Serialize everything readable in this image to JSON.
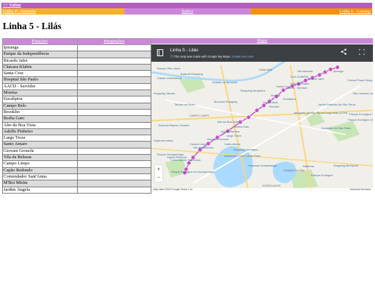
{
  "top": {
    "back": "<< Voltar"
  },
  "nav": {
    "prev": "Linha 4 - Amarela",
    "index": "Índice",
    "next": "Linha 6 - Laranja"
  },
  "title": "Linha 5 - Lilás",
  "table": {
    "headers": [
      "Estações",
      "Integrações"
    ],
    "stations": [
      "Ipiranga",
      "Parque da Independência",
      "Ricardo Jafet",
      "Chácara Klabin",
      "Santa Cruz",
      "Hospital São Paulo",
      "AACD - Servidor",
      "Moema",
      "Eucaliptos",
      "Campo Belo",
      "Brooklin",
      "Borba Gato",
      "Alto da Boa Vista",
      "Adolfo Pinheiro",
      "Largo Treze",
      "Santo Amaro",
      "Giovani Gronchi",
      "Vila da Belezas",
      "Campo Limpo",
      "Capão Redondo",
      "Comendador Sant'Anna",
      "M'Boi Mirim",
      "Jardim Ângela"
    ]
  },
  "map": {
    "header": "Mapa",
    "title": "Linha 5 - Lilás",
    "notice": "This map was made with Google My Maps.",
    "notice_link": "Create your own",
    "labels": [
      "Butantã Shopping",
      "Cidade Universitária",
      "Estádio do Morumbi",
      "Parque Villa Lobos",
      "Rodovia Raposo Tavares",
      "ITAIM BIBI",
      "VILA OLÍMPIA",
      "Ricardo Jafet",
      "Central Plaza Shopping",
      "Shopping Ibirapuera",
      "Shopping Taboão",
      "Morumbi Shopping",
      "Taboão da Serra",
      "CAMPO LIMPO",
      "AACD - Servidor",
      "Aeroporto de São Paulo/Congonhas (CGH)",
      "Jardim Botânico de São Paulo",
      "Zoológico de São Paulo",
      "Parque Ecológico Chico Mendes",
      "Santo Amaro",
      "Shopping Interlagos",
      "Autódromo José Carlos Pace",
      "Represa Guarapiranga",
      "Diadema",
      "Shopping Metrópole",
      "Parque Ecológico do Guarapiranga",
      "Parque Ecológico",
      "INTERLAGOS",
      "CIDADE DUTRA",
      "Vila Mariana",
      "Brooklin",
      "Moema",
      "Santa Cruz",
      "Chácara Klabin",
      "Parque Ecológico Chico Mendes",
      "Ipiranga",
      "São Caetano do Sul",
      "Eucaliptos",
      "Campo Belo",
      "Alto da Boa Vista",
      "Borba Gato",
      "Largo Treze",
      "Adolfo Pinheiro",
      "Giovanni Gronchi",
      "Vila das Belezas",
      "Campo Limpo",
      "Capão Redondo",
      "Comendador Sant'Anna",
      "Parque Guarapiranga",
      "Supermercados"
    ],
    "footer_left": "Map data ©2023 Google   Terms   1 mi",
    "footer_right": "Keyboard shortcuts",
    "zoom_in": "+",
    "zoom_out": "−",
    "colors": {
      "station": "#c653c6",
      "road": "#fbd67d",
      "water": "#aadaff",
      "park": "#c8e6b5",
      "bar": "#3c4043"
    }
  }
}
